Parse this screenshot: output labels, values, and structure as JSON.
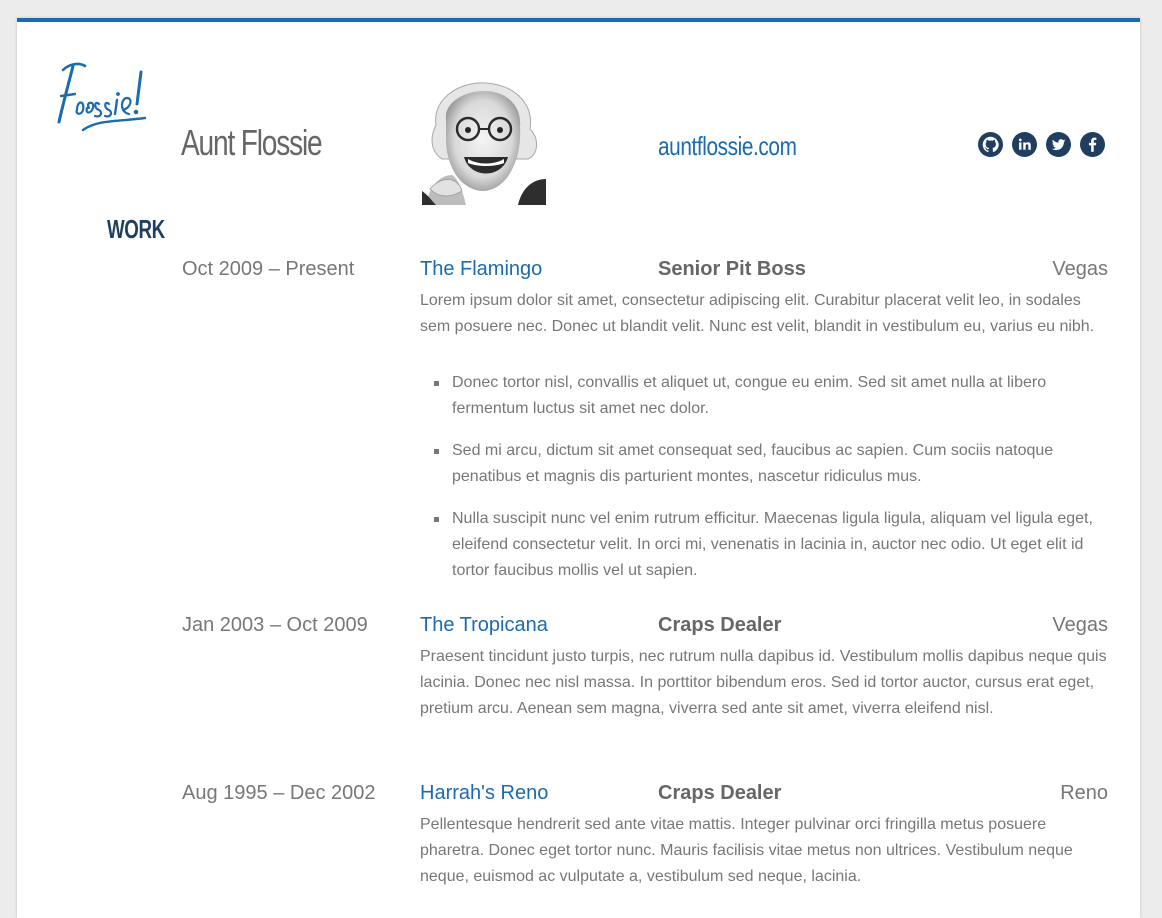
{
  "header": {
    "name": "Aunt Flossie",
    "website": "auntflossie.com",
    "colors": {
      "accent": "#1a6bb0",
      "dark_blue": "#1f3e60",
      "text": "#777777"
    },
    "social_icons": [
      "github-icon",
      "linkedin-icon",
      "twitter-icon",
      "facebook-icon"
    ]
  },
  "work": {
    "title": "WORK",
    "jobs": [
      {
        "dates": "Oct 2009 – Present",
        "company": "The Flamingo",
        "position": "Senior Pit Boss",
        "location": "Vegas",
        "summary": "Lorem ipsum dolor sit amet, consectetur adipiscing elit. Curabitur placerat velit leo, in sodales sem posuere nec. Donec ut blandit velit. Nunc est velit, blandit in vestibulum eu, varius eu nibh.",
        "highlights": [
          "Donec tortor nisl, convallis et aliquet ut, congue eu enim. Sed sit amet nulla at libero fermentum luctus sit amet nec dolor.",
          "Sed mi arcu, dictum sit amet consequat sed, faucibus ac sapien. Cum sociis natoque penatibus et magnis dis parturient montes, nascetur ridiculus mus.",
          "Nulla suscipit nunc vel enim rutrum efficitur. Maecenas ligula ligula, aliquam vel ligula eget, eleifend consectetur velit. In orci mi, venenatis in lacinia in, auctor nec odio. Ut eget elit id tortor faucibus mollis vel ut sapien."
        ]
      },
      {
        "dates": "Jan 2003 – Oct 2009",
        "company": "The Tropicana",
        "position": "Craps Dealer",
        "location": "Vegas",
        "summary": "Praesent tincidunt justo turpis, nec rutrum nulla dapibus id. Vestibulum mollis dapibus neque quis lacinia. Donec nec nisl massa. In porttitor bibendum eros. Sed id tortor auctor, cursus erat eget, pretium arcu. Aenean sem magna, viverra sed ante sit amet, viverra eleifend nisl."
      },
      {
        "dates": "Aug 1995 – Dec 2002",
        "company": "Harrah's Reno",
        "position": "Craps Dealer",
        "location": "Reno",
        "summary": "Pellentesque hendrerit sed ante vitae mattis. Integer pulvinar orci fringilla metus posuere pharetra. Donec eget tortor nunc. Mauris facilisis vitae metus non ultrices. Vestibulum neque neque, euismod ac vulputate a, vestibulum sed neque, lacinia."
      }
    ]
  }
}
